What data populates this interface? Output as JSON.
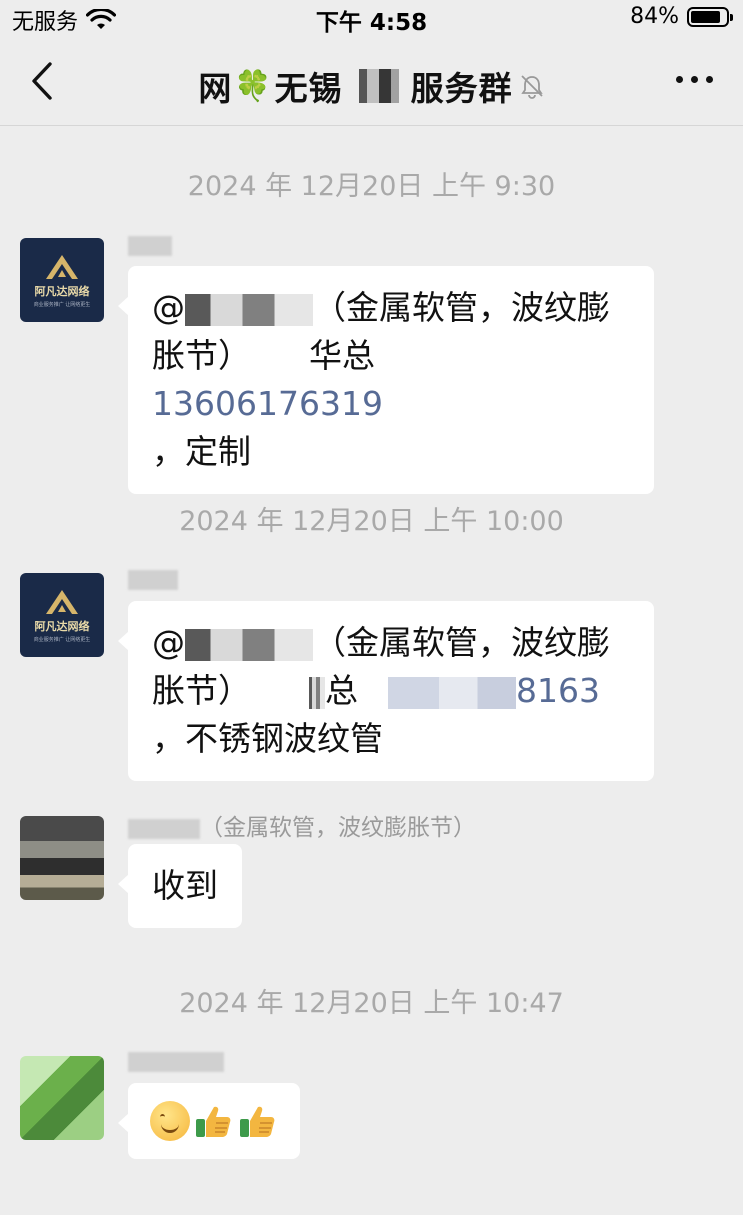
{
  "status_bar": {
    "carrier": "无服务",
    "time": "下午 4:58",
    "battery_percent": "84%",
    "battery_level": 0.84
  },
  "nav": {
    "title_prefix": "网",
    "title_emoji": "🍀",
    "title_mid": "无锡",
    "title_suffix": "服务群",
    "muted_icon": "bell-slash-icon"
  },
  "messages": [
    {
      "timestamp": "2024 年 12月20日 上午 9:30",
      "sender": "",
      "avatar_text": "阿凡达网络",
      "avatar_tagline": "商业服务推广 让网络更生",
      "line1_prefix": "@",
      "line1_suffix": "（金属软管，波纹膨",
      "line2_prefix": "胀节）",
      "line2_name": "华总",
      "phone": "13606176319",
      "line3": "，定制"
    },
    {
      "timestamp": "2024 年 12月20日 上午 10:00",
      "sender": "",
      "avatar_text": "阿凡达网络",
      "avatar_tagline": "商业服务推广 让网络更生",
      "line1_prefix": "@",
      "line1_suffix": "（金属软管，波纹膨",
      "line2_prefix": "胀节）",
      "line2_name": "总",
      "phone_visible": "8163",
      "line3": "，不锈钢波纹管"
    },
    {
      "sender_suffix": "（金属软管，波纹膨胀节）",
      "text": "收到"
    },
    {
      "timestamp": "2024 年 12月20日 上午 10:47",
      "sender": "",
      "emojis": [
        "smile-emoji",
        "thumbs-up-emoji",
        "thumbs-up-emoji"
      ]
    }
  ]
}
